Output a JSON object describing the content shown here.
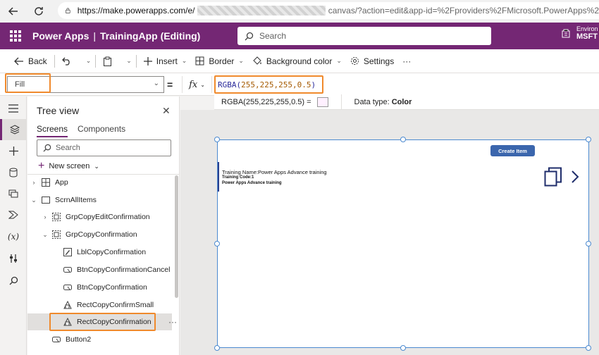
{
  "browser": {
    "url_host": "https://make.powerapps.com/e/",
    "url_rest": "canvas/?action=edit&app-id=%2Fproviders%2FMicrosoft.PowerApps%2"
  },
  "header": {
    "product": "Power Apps",
    "separator": "|",
    "app_name": "TrainingApp (Editing)",
    "search_placeholder": "Search",
    "env_label": "Environ",
    "env_name": "MSFT"
  },
  "commands": {
    "back": "Back",
    "insert": "Insert",
    "border": "Border",
    "background_color": "Background color",
    "settings": "Settings",
    "more": "···"
  },
  "formula": {
    "property": "Fill",
    "equals": "=",
    "fx": "fx",
    "fn_name": "RGBA(",
    "fn_args": "255,225,255,0.5",
    "fn_close": ")"
  },
  "intellisense": {
    "value": "RGBA(255,225,255,0.5)  =",
    "datatype_label": "Data type:",
    "datatype_value": "Color",
    "swatch_color": "#ffe1ff"
  },
  "tree": {
    "title": "Tree view",
    "tabs": [
      "Screens",
      "Components"
    ],
    "search_placeholder": "Search",
    "new_screen": "New screen",
    "rows": [
      {
        "label": "App",
        "icon": "app-icon"
      },
      {
        "label": "ScrnAllItems",
        "icon": "screen-icon"
      },
      {
        "label": "GrpCopyEditConfirmation",
        "icon": "group-icon"
      },
      {
        "label": "GrpCopyConfirmation",
        "icon": "group-icon"
      },
      {
        "label": "LblCopyConfirmation",
        "icon": "label-icon"
      },
      {
        "label": "BtnCopyConfirmationCancel",
        "icon": "button-icon"
      },
      {
        "label": "BtnCopyConfirmation",
        "icon": "button-icon"
      },
      {
        "label": "RectCopyConfirmSmall",
        "icon": "rectangle-icon"
      },
      {
        "label": "RectCopyConfirmation",
        "icon": "rectangle-icon"
      },
      {
        "label": "Button2",
        "icon": "button-icon"
      }
    ],
    "selected_more": "···"
  },
  "canvas": {
    "create_button": "Create Item",
    "item_name": "Training Name:Power Apps Advance training",
    "item_code": "Training Code:1",
    "item_desc": "Power Apps Advance training",
    "accent_color": "#3b66ad"
  },
  "colors": {
    "brand": "#742774",
    "highlight": "#f08a2c",
    "selection": "#4c8ad0"
  }
}
